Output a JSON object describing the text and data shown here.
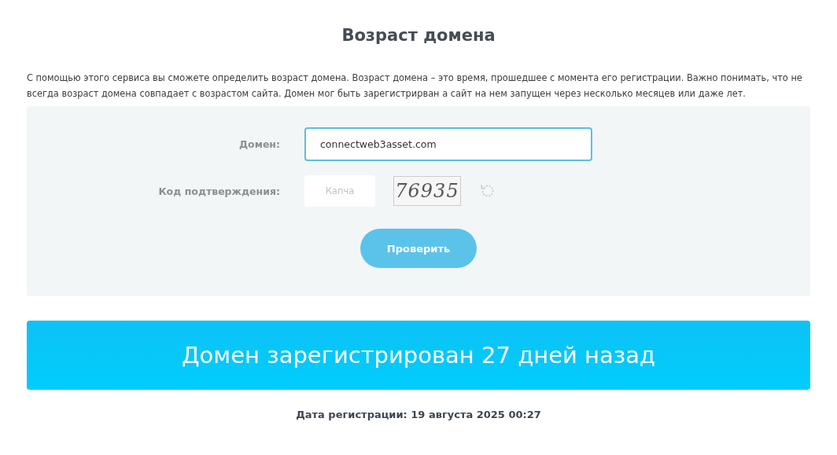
{
  "title": "Возраст домена",
  "description": "С помощью этого сервиса вы сможете определить возраст домена. Возраст домена – это время, прошедшее с момента его регистрации. Важно понимать, что не всегда возраст домена совпадает с возрастом сайта. Домен мог быть зарегистрирван а сайт на нем запущен через несколько месяцев или даже лет.",
  "form": {
    "domain": {
      "label": "Домен:",
      "value": "connectweb3asset.com",
      "focused": true
    },
    "captcha": {
      "label": "Код подтверждения:",
      "placeholder": "Капча",
      "code": "76935"
    },
    "submit": "Проверить"
  },
  "result": {
    "headline": "Домен зарегистрирован 27 дней назад",
    "date": "Дата регистрации: 19 августа 2025 00:27"
  }
}
